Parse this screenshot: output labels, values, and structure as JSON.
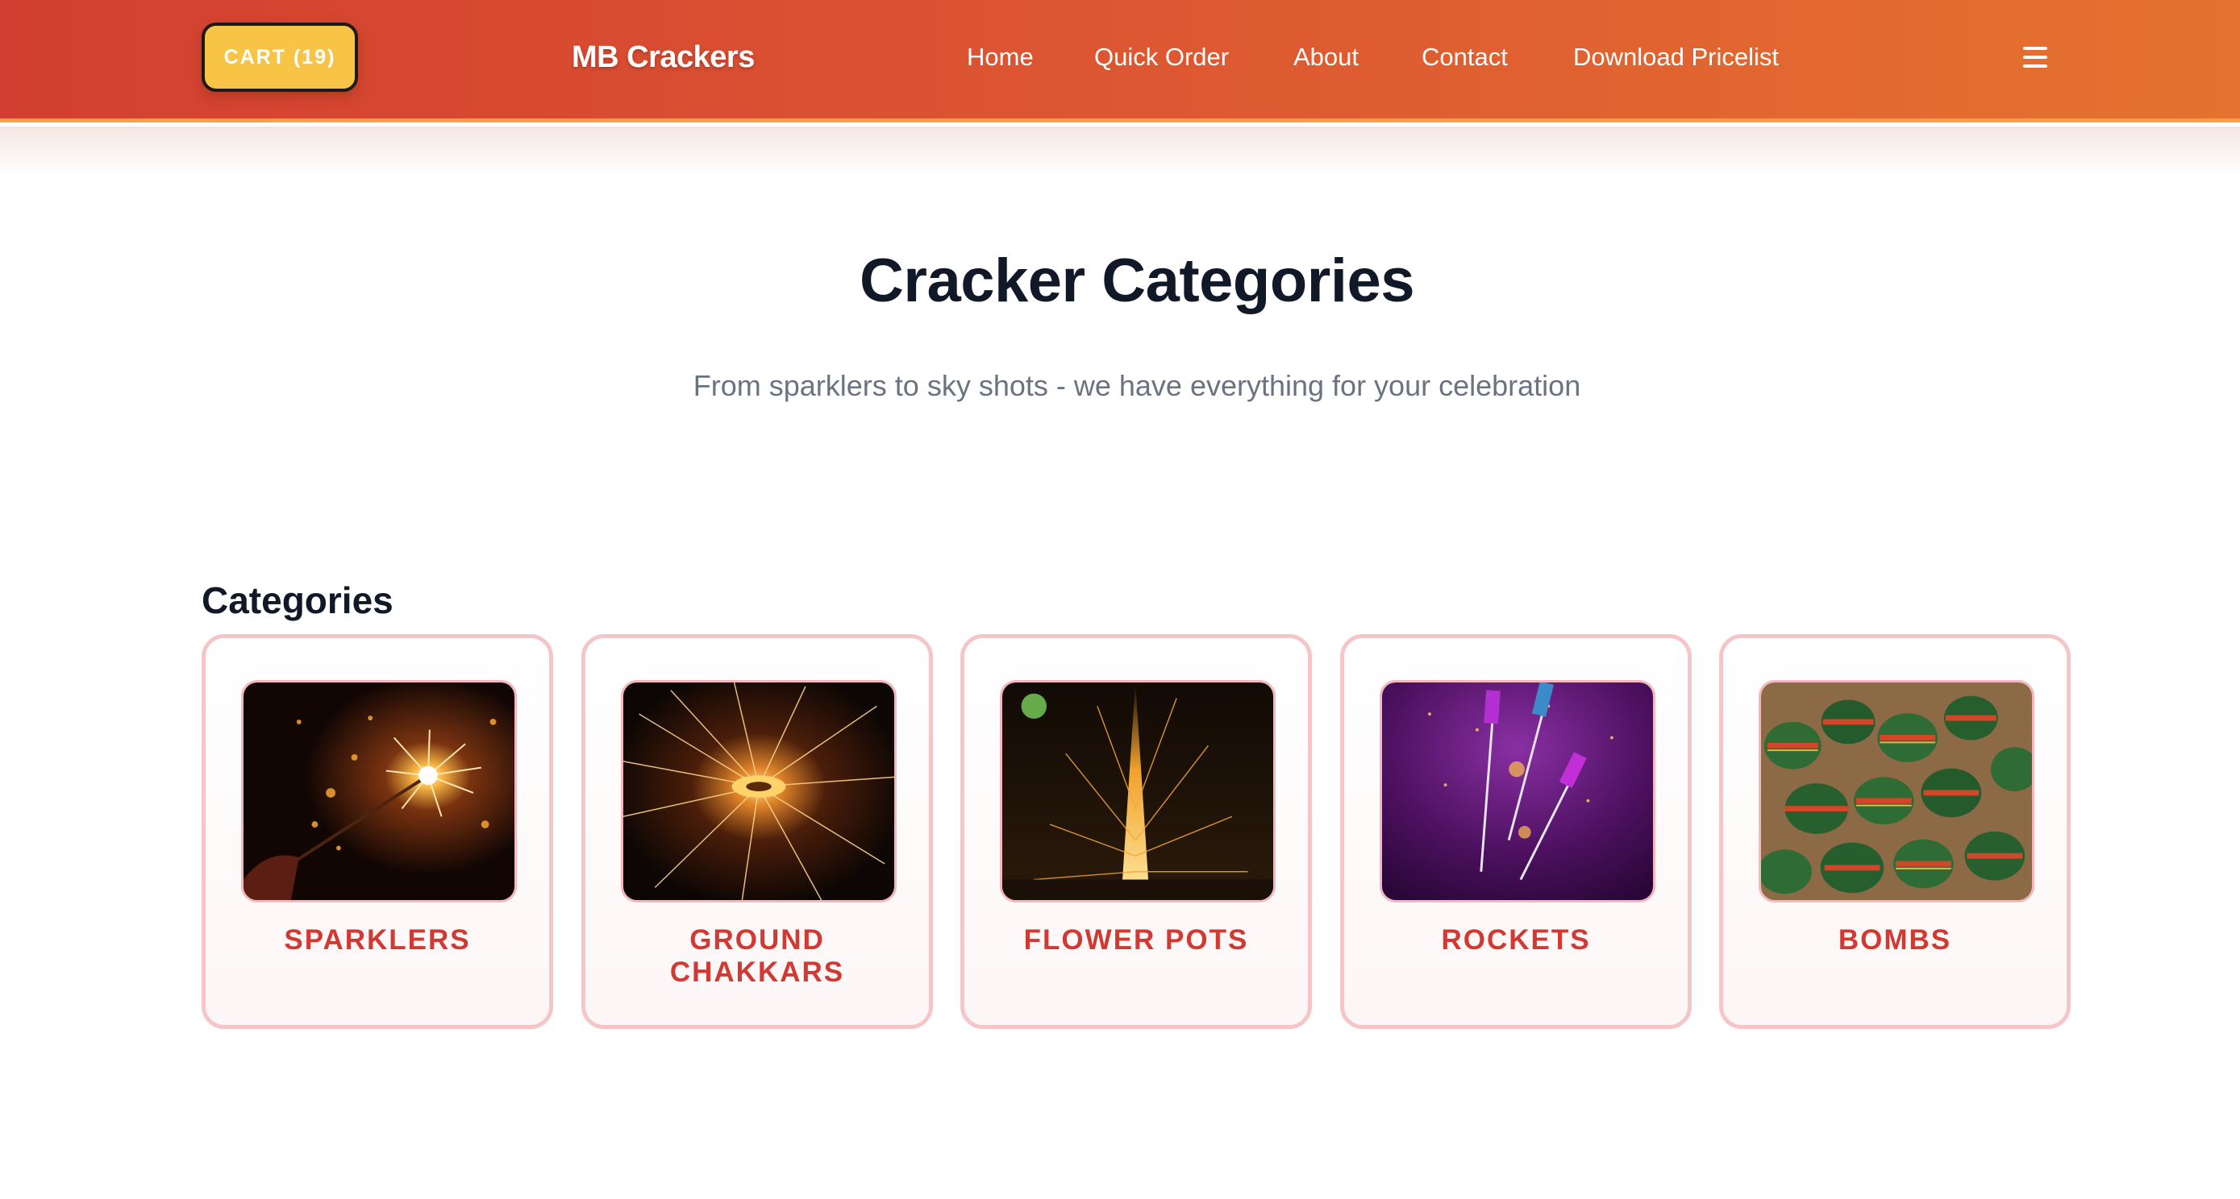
{
  "header": {
    "cart_label": "CART (19)",
    "brand": "MB Crackers",
    "nav": [
      "Home",
      "Quick Order",
      "About",
      "Contact",
      "Download Pricelist"
    ],
    "menu_icon": "hamburger-menu-icon"
  },
  "hero": {
    "title": "Cracker Categories",
    "subtitle": "From sparklers to sky shots - we have everything for your celebration"
  },
  "categories": {
    "heading": "Categories",
    "items": [
      {
        "label": "SPARKLERS",
        "image": "sparkler-photo"
      },
      {
        "label": "GROUND\nCHAKKARS",
        "image": "ground-chakkar-photo"
      },
      {
        "label": "FLOWER POTS",
        "image": "flower-pot-photo"
      },
      {
        "label": "ROCKETS",
        "image": "rocket-photo"
      },
      {
        "label": "BOMBS",
        "image": "bomb-photo"
      }
    ]
  },
  "colors": {
    "header_start": "#d23f30",
    "header_end": "#e5722f",
    "cart_button": "#f7c446",
    "category_label": "#d13a32",
    "card_border": "#f6c5c7",
    "subtitle": "#6b7280"
  }
}
